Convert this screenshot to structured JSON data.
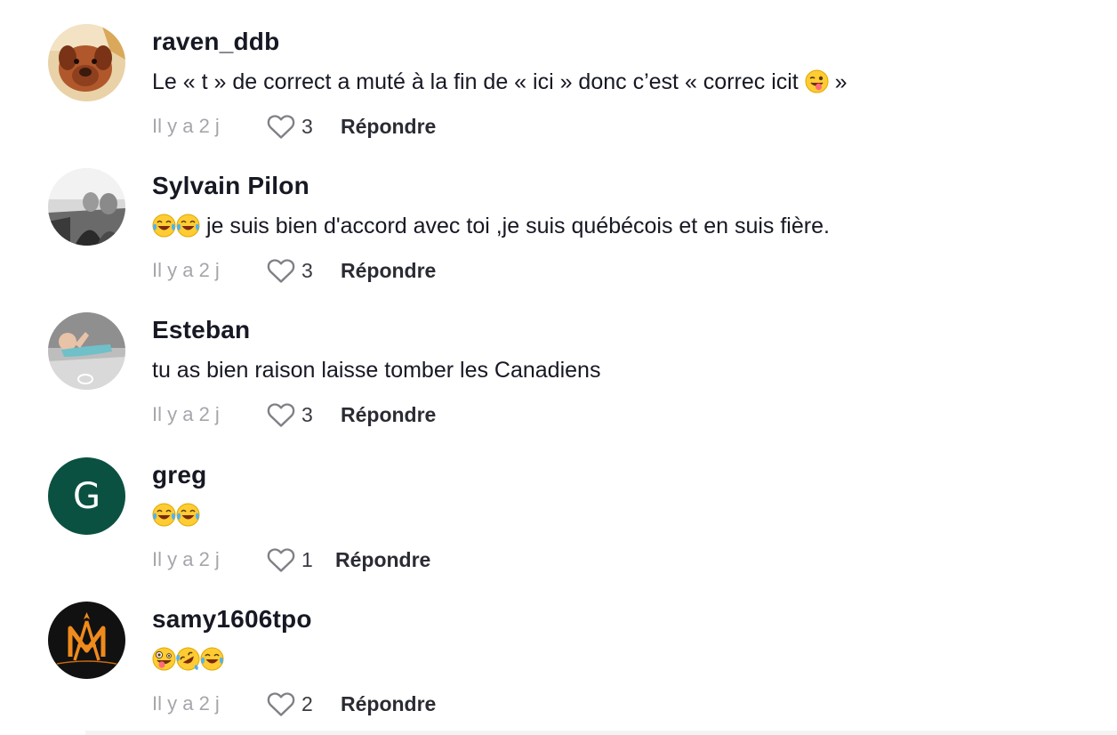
{
  "comments": [
    {
      "username": "raven_ddb",
      "text_before": "Le « t » de correct a muté à la fin de « ici » donc c’est « correc icit ",
      "text_after": " »",
      "time": "Il y a 2 j",
      "likes": "3",
      "reply_label": "Répondre",
      "avatar_icon": "dog-photo"
    },
    {
      "username": "Sylvain Pilon",
      "text_after": " je suis bien d'accord avec toi ,je suis québécois et en suis fière.",
      "time": "Il y a 2 j",
      "likes": "3",
      "reply_label": "Répondre",
      "avatar_icon": "couple-photo"
    },
    {
      "username": "Esteban",
      "text": "tu as bien raison laisse tomber les Canadiens",
      "time": "Il y a 2 j",
      "likes": "3",
      "reply_label": "Répondre",
      "avatar_icon": "baby-photo"
    },
    {
      "username": "greg",
      "avatar_letter": "G",
      "avatar_color": "#0b5142",
      "time": "Il y a 2 j",
      "likes": "1",
      "reply_label": "Répondre"
    },
    {
      "username": "samy1606tpo",
      "time": "Il y a 2 j",
      "likes": "2",
      "reply_label": "Répondre",
      "avatar_icon": "om-logo"
    }
  ]
}
